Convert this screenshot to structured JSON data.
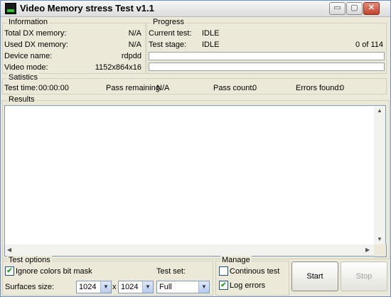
{
  "window": {
    "title": "Video Memory stress Test v1.1",
    "buttons": {
      "minimize": "▭",
      "maximize": "▢",
      "close": "✕"
    }
  },
  "information": {
    "title": "Information",
    "rows": [
      {
        "label": "Total DX memory:",
        "value": "N/A"
      },
      {
        "label": "Used DX memory:",
        "value": "N/A"
      },
      {
        "label": "Device name:",
        "value": "rdpdd"
      },
      {
        "label": "Video mode:",
        "value": "1152x864x16"
      }
    ]
  },
  "progress": {
    "title": "Progress",
    "current_test_label": "Current test:",
    "current_test_value": "IDLE",
    "test_stage_label": "Test stage:",
    "test_stage_value": "IDLE",
    "stage_count": "0 of 114",
    "bar1_fraction": 0,
    "bar2_fraction": 0
  },
  "statistics": {
    "title": "Satistics",
    "test_time_label": "Test time:",
    "test_time_value": "00:00:00",
    "pass_remaining_label": "Pass remaining:",
    "pass_remaining_value": "N/A",
    "pass_count_label": "Pass count:",
    "pass_count_value": "0",
    "errors_found_label": "Errors found:",
    "errors_found_value": "0"
  },
  "results": {
    "title": "Results"
  },
  "test_options": {
    "title": "Test options",
    "ignore_colors_label": "Ignore colors bit mask",
    "ignore_colors_checked": true,
    "test_set_label": "Test set:",
    "surfaces_size_label": "Surfaces size:",
    "width_value": "1024",
    "x_sep": "x",
    "height_value": "1024",
    "test_set_value": "Full"
  },
  "manage": {
    "title": "Manage",
    "continuous_label": "Continous test",
    "continuous_checked": false,
    "log_errors_label": "Log errors",
    "log_errors_checked": true
  },
  "actions": {
    "start": "Start",
    "stop": "Stop"
  },
  "icons": {
    "check": "✔",
    "arrow_up": "▲",
    "arrow_down": "▼",
    "arrow_left": "◀",
    "arrow_right": "▶",
    "dropdown": "▼"
  }
}
